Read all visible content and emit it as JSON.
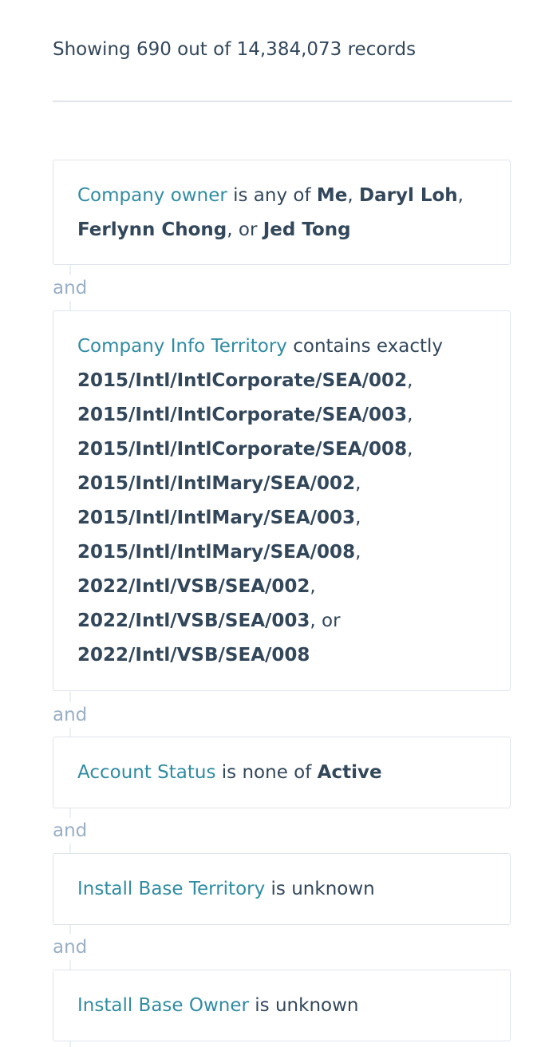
{
  "summary": {
    "text": "Showing 690 out of 14,384,073 records"
  },
  "conjunction": "and",
  "filters": [
    {
      "property": "Company owner",
      "operator": "is any of",
      "values": [
        "Me",
        "Daryl Loh",
        "Ferlynn Chong",
        "Jed Tong"
      ]
    },
    {
      "property": "Company Info Territory",
      "operator": "contains exactly",
      "values": [
        "2015/Intl/IntlCorporate/SEA/002",
        "2015/Intl/IntlCorporate/SEA/003",
        "2015/Intl/IntlCorporate/SEA/008",
        "2015/Intl/IntlMary/SEA/002",
        "2015/Intl/IntlMary/SEA/003",
        "2015/Intl/IntlMary/SEA/008",
        "2022/Intl/VSB/SEA/002",
        "2022/Intl/VSB/SEA/003",
        "2022/Intl/VSB/SEA/008"
      ]
    },
    {
      "property": "Account Status",
      "operator": "is none of",
      "values": [
        "Active"
      ]
    },
    {
      "property": "Install Base Territory",
      "operator": "is unknown",
      "values": []
    },
    {
      "property": "Install Base Owner",
      "operator": "is unknown",
      "values": []
    }
  ],
  "separators": {
    "comma": ",",
    "or": "or"
  },
  "colors": {
    "property_link": "#2f8ca3",
    "body_text": "#33475b",
    "conjunction_text": "#99afc4",
    "card_border": "#dfe3eb"
  }
}
